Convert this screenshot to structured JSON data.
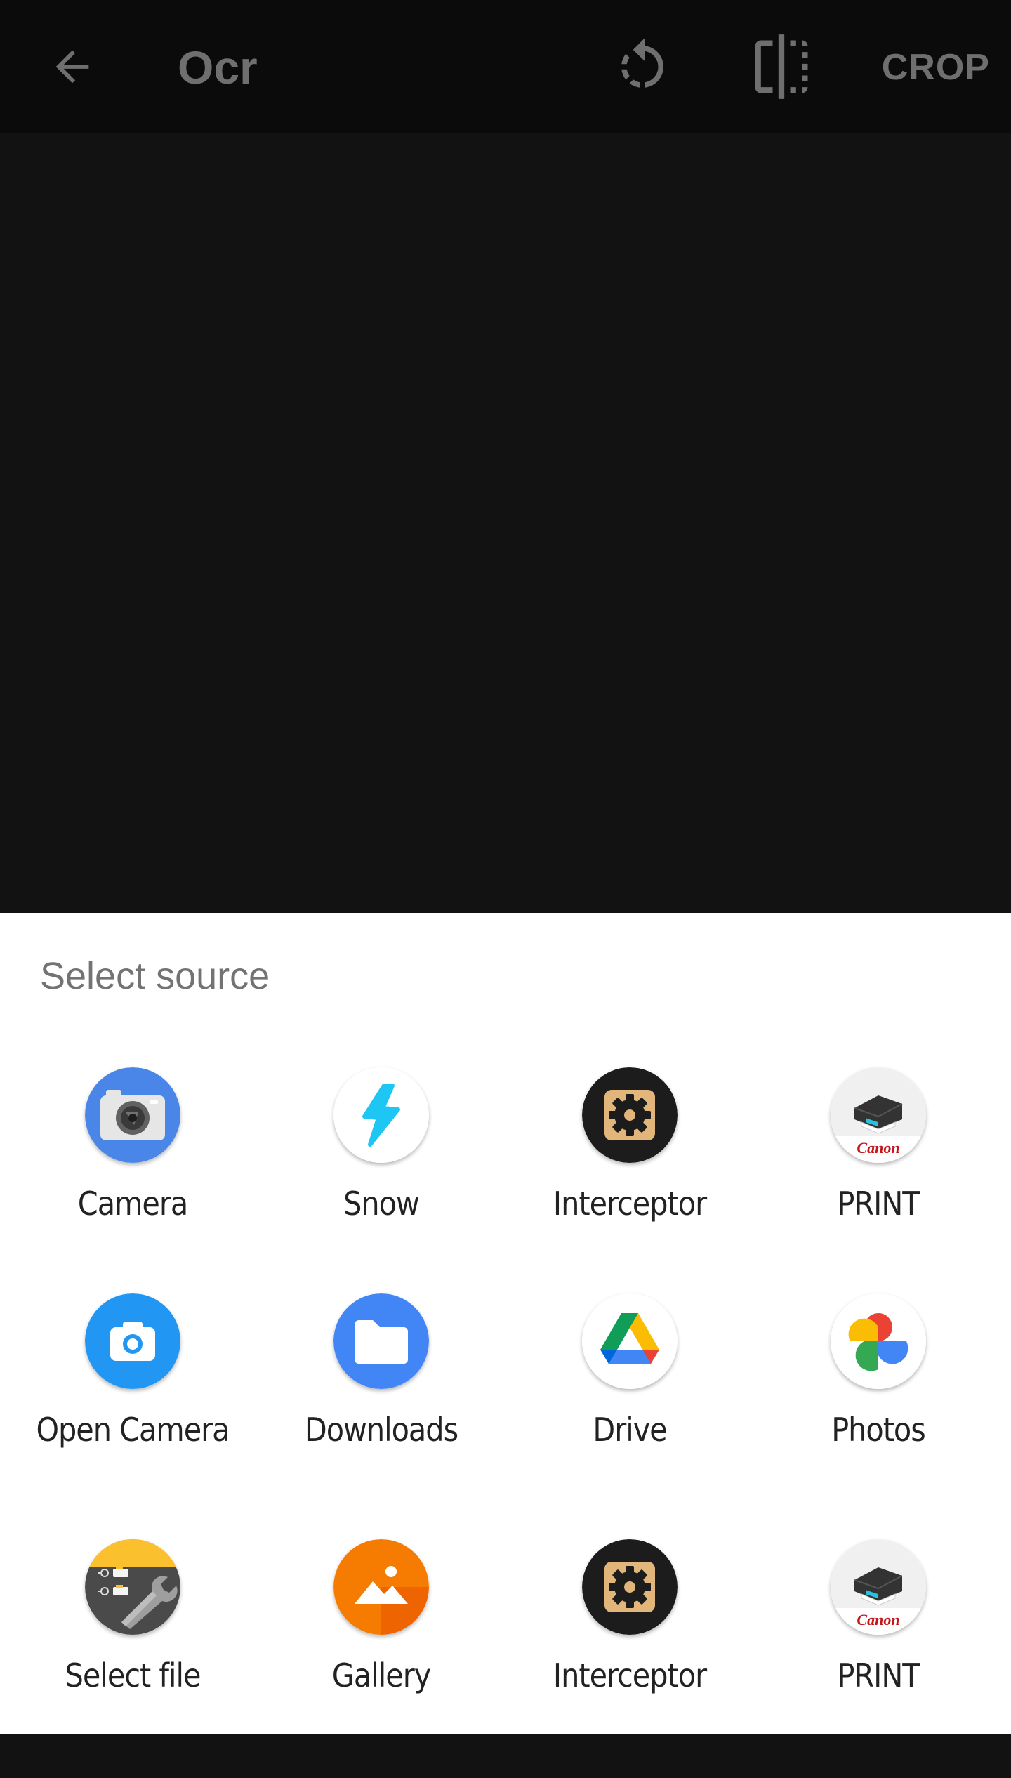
{
  "toolbar": {
    "title": "Ocr",
    "crop_label": "CROP",
    "back_icon": "arrow-left-icon",
    "rotate_icon": "rotate-icon",
    "flip_icon": "flip-icon"
  },
  "sheet": {
    "title": "Select source",
    "apps": [
      {
        "label": "Camera",
        "icon": "camera-icon"
      },
      {
        "label": "Snow",
        "icon": "snow-icon"
      },
      {
        "label": "Interceptor",
        "icon": "interceptor-icon"
      },
      {
        "label": "PRINT",
        "icon": "canon-print-icon",
        "brand": "Canon"
      },
      {
        "label": "Open Camera",
        "icon": "open-camera-icon"
      },
      {
        "label": "Downloads",
        "icon": "folder-icon"
      },
      {
        "label": "Drive",
        "icon": "drive-icon"
      },
      {
        "label": "Photos",
        "icon": "photos-icon"
      },
      {
        "label": "Select file",
        "icon": "file-manager-icon"
      },
      {
        "label": "Gallery",
        "icon": "gallery-icon"
      },
      {
        "label": "Interceptor",
        "icon": "interceptor-icon"
      },
      {
        "label": "PRINT",
        "icon": "canon-print-icon",
        "brand": "Canon"
      }
    ]
  },
  "colors": {
    "toolbar_bg": "#0b0b0b",
    "preview_bg": "#121212",
    "toolbar_fg": "#6f6f6f",
    "sheet_bg": "#ffffff"
  }
}
